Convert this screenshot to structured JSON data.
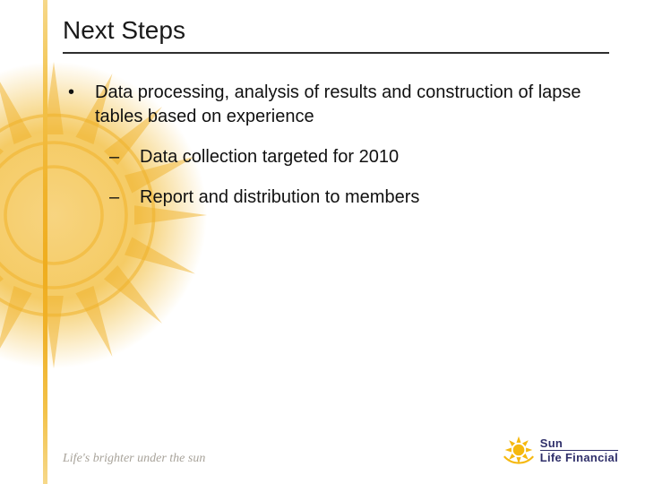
{
  "title": "Next Steps",
  "bullets": {
    "main": "Data processing, analysis of results and construction of lapse tables based on experience",
    "sub1": "Data collection targeted for 2010",
    "sub2": "Report and distribution to members"
  },
  "footer": {
    "tagline": "Life's brighter under the sun",
    "logo_top": "Sun",
    "logo_bottom": "Life Financial"
  },
  "colors": {
    "accent_gold": "#efad1f",
    "logo_navy": "#2f2f6a"
  }
}
